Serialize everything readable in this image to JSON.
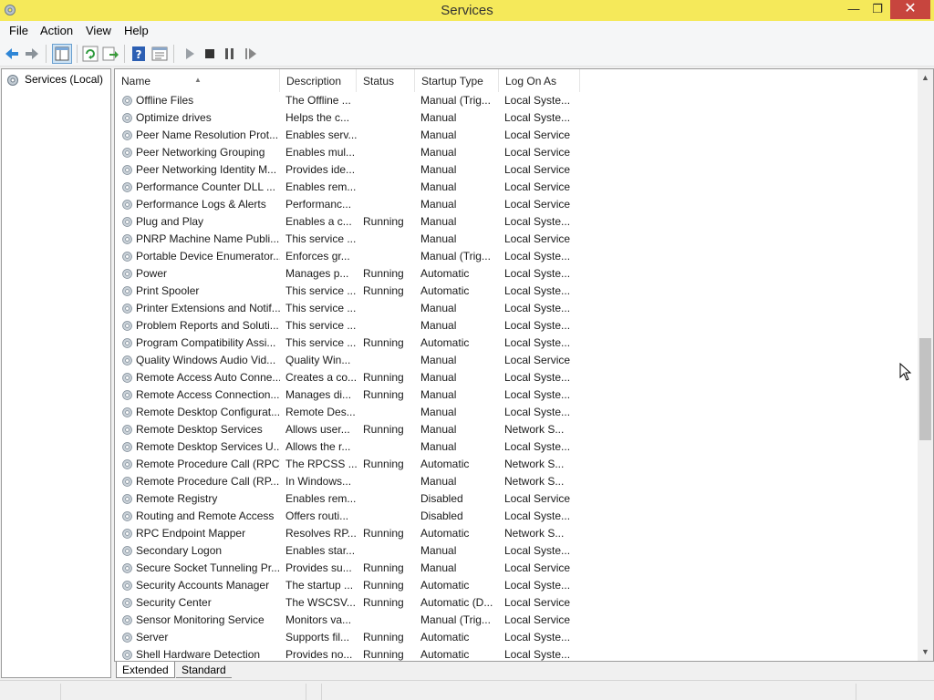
{
  "window": {
    "title": "Services"
  },
  "title_buttons": {
    "minimize": "—",
    "restore": "❐",
    "close": "✕"
  },
  "menu": [
    "File",
    "Action",
    "View",
    "Help"
  ],
  "toolbar": [
    "back-icon",
    "forward-icon",
    "show-hide-tree-icon",
    "refresh-icon",
    "export-list-icon",
    "help-icon",
    "properties-icon",
    "start-icon",
    "stop-icon",
    "pause-icon",
    "resume-icon"
  ],
  "tree": {
    "root_label": "Services (Local)"
  },
  "columns": [
    "Name",
    "Description",
    "Status",
    "Startup Type",
    "Log On As"
  ],
  "rows": [
    {
      "name": "Offline Files",
      "description": "The Offline ...",
      "status": "",
      "startup": "Manual (Trig...",
      "logon": "Local Syste..."
    },
    {
      "name": "Optimize drives",
      "description": "Helps the c...",
      "status": "",
      "startup": "Manual",
      "logon": "Local Syste..."
    },
    {
      "name": "Peer Name Resolution Prot...",
      "description": "Enables serv...",
      "status": "",
      "startup": "Manual",
      "logon": "Local Service"
    },
    {
      "name": "Peer Networking Grouping",
      "description": "Enables mul...",
      "status": "",
      "startup": "Manual",
      "logon": "Local Service"
    },
    {
      "name": "Peer Networking Identity M...",
      "description": "Provides ide...",
      "status": "",
      "startup": "Manual",
      "logon": "Local Service"
    },
    {
      "name": "Performance Counter DLL ...",
      "description": "Enables rem...",
      "status": "",
      "startup": "Manual",
      "logon": "Local Service"
    },
    {
      "name": "Performance Logs & Alerts",
      "description": "Performanc...",
      "status": "",
      "startup": "Manual",
      "logon": "Local Service"
    },
    {
      "name": "Plug and Play",
      "description": "Enables a c...",
      "status": "Running",
      "startup": "Manual",
      "logon": "Local Syste..."
    },
    {
      "name": "PNRP Machine Name Publi...",
      "description": "This service ...",
      "status": "",
      "startup": "Manual",
      "logon": "Local Service"
    },
    {
      "name": "Portable Device Enumerator...",
      "description": "Enforces gr...",
      "status": "",
      "startup": "Manual (Trig...",
      "logon": "Local Syste..."
    },
    {
      "name": "Power",
      "description": "Manages p...",
      "status": "Running",
      "startup": "Automatic",
      "logon": "Local Syste..."
    },
    {
      "name": "Print Spooler",
      "description": "This service ...",
      "status": "Running",
      "startup": "Automatic",
      "logon": "Local Syste..."
    },
    {
      "name": "Printer Extensions and Notif...",
      "description": "This service ...",
      "status": "",
      "startup": "Manual",
      "logon": "Local Syste..."
    },
    {
      "name": "Problem Reports and Soluti...",
      "description": "This service ...",
      "status": "",
      "startup": "Manual",
      "logon": "Local Syste..."
    },
    {
      "name": "Program Compatibility Assi...",
      "description": "This service ...",
      "status": "Running",
      "startup": "Automatic",
      "logon": "Local Syste..."
    },
    {
      "name": "Quality Windows Audio Vid...",
      "description": "Quality Win...",
      "status": "",
      "startup": "Manual",
      "logon": "Local Service"
    },
    {
      "name": "Remote Access Auto Conne...",
      "description": "Creates a co...",
      "status": "Running",
      "startup": "Manual",
      "logon": "Local Syste..."
    },
    {
      "name": "Remote Access Connection...",
      "description": "Manages di...",
      "status": "Running",
      "startup": "Manual",
      "logon": "Local Syste..."
    },
    {
      "name": "Remote Desktop Configurat...",
      "description": "Remote Des...",
      "status": "",
      "startup": "Manual",
      "logon": "Local Syste..."
    },
    {
      "name": "Remote Desktop Services",
      "description": "Allows user...",
      "status": "Running",
      "startup": "Manual",
      "logon": "Network S..."
    },
    {
      "name": "Remote Desktop Services U...",
      "description": "Allows the r...",
      "status": "",
      "startup": "Manual",
      "logon": "Local Syste..."
    },
    {
      "name": "Remote Procedure Call (RPC)",
      "description": "The RPCSS ...",
      "status": "Running",
      "startup": "Automatic",
      "logon": "Network S..."
    },
    {
      "name": "Remote Procedure Call (RP...",
      "description": "In Windows...",
      "status": "",
      "startup": "Manual",
      "logon": "Network S..."
    },
    {
      "name": "Remote Registry",
      "description": "Enables rem...",
      "status": "",
      "startup": "Disabled",
      "logon": "Local Service"
    },
    {
      "name": "Routing and Remote Access",
      "description": "Offers routi...",
      "status": "",
      "startup": "Disabled",
      "logon": "Local Syste..."
    },
    {
      "name": "RPC Endpoint Mapper",
      "description": "Resolves RP...",
      "status": "Running",
      "startup": "Automatic",
      "logon": "Network S..."
    },
    {
      "name": "Secondary Logon",
      "description": "Enables star...",
      "status": "",
      "startup": "Manual",
      "logon": "Local Syste..."
    },
    {
      "name": "Secure Socket Tunneling Pr...",
      "description": "Provides su...",
      "status": "Running",
      "startup": "Manual",
      "logon": "Local Service"
    },
    {
      "name": "Security Accounts Manager",
      "description": "The startup ...",
      "status": "Running",
      "startup": "Automatic",
      "logon": "Local Syste..."
    },
    {
      "name": "Security Center",
      "description": "The WSCSV...",
      "status": "Running",
      "startup": "Automatic (D...",
      "logon": "Local Service"
    },
    {
      "name": "Sensor Monitoring Service",
      "description": "Monitors va...",
      "status": "",
      "startup": "Manual (Trig...",
      "logon": "Local Service"
    },
    {
      "name": "Server",
      "description": "Supports fil...",
      "status": "Running",
      "startup": "Automatic",
      "logon": "Local Syste..."
    },
    {
      "name": "Shell Hardware Detection",
      "description": "Provides no...",
      "status": "Running",
      "startup": "Automatic",
      "logon": "Local Syste..."
    }
  ],
  "tabs": [
    "Extended",
    "Standard"
  ],
  "scrollbar": {
    "position_fraction": 0.45
  },
  "colors": {
    "titlebar": "#f5e95a",
    "close_button": "#c7453e",
    "grid_background": "#ffffff",
    "selection_border": "#9c9c9c"
  }
}
